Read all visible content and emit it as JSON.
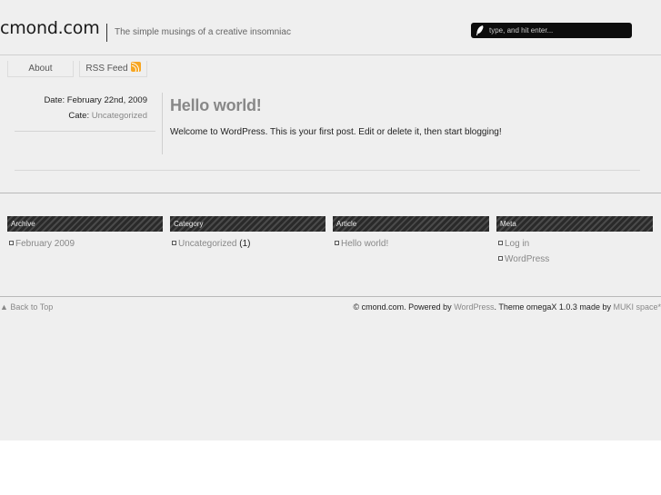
{
  "header": {
    "site_title": "cmond.com",
    "tagline": "The simple musings of a creative insomniac",
    "search_placeholder": "type, and hit enter..."
  },
  "nav": {
    "items": [
      {
        "label": "About"
      },
      {
        "label": "RSS Feed",
        "icon": "rss-icon"
      }
    ]
  },
  "post": {
    "date_label": "Date:",
    "date": "February 22nd, 2009",
    "category_label": "Cate:",
    "category": "Uncategorized",
    "title": "Hello world!",
    "body": "Welcome to WordPress. This is your first post. Edit or delete it, then start blogging!"
  },
  "widgets": [
    {
      "heading": "Archive",
      "items": [
        {
          "link": "February 2009",
          "suffix": ""
        }
      ]
    },
    {
      "heading": "Category",
      "items": [
        {
          "link": "Uncategorized",
          "suffix": " (1)"
        }
      ]
    },
    {
      "heading": "Article",
      "items": [
        {
          "link": "Hello world!",
          "suffix": ""
        }
      ]
    },
    {
      "heading": "Meta",
      "items": [
        {
          "link": "Log in",
          "suffix": ""
        },
        {
          "link": "WordPress",
          "suffix": ""
        }
      ]
    }
  ],
  "footer": {
    "back_to_top": "▲ Back to Top",
    "credits_prefix": "© cmond.com. Powered by ",
    "powered_by_link": "WordPress",
    "credits_middle": ". Theme omegaX 1.0.3 made by ",
    "author_link": "MUKI space*"
  },
  "colors": {
    "page_background": "#efefef",
    "link_gray": "#888888",
    "search_background": "#0d0d0d",
    "rss_orange": "#f6a623",
    "widget_heading_dark": "#2a2a2a"
  }
}
